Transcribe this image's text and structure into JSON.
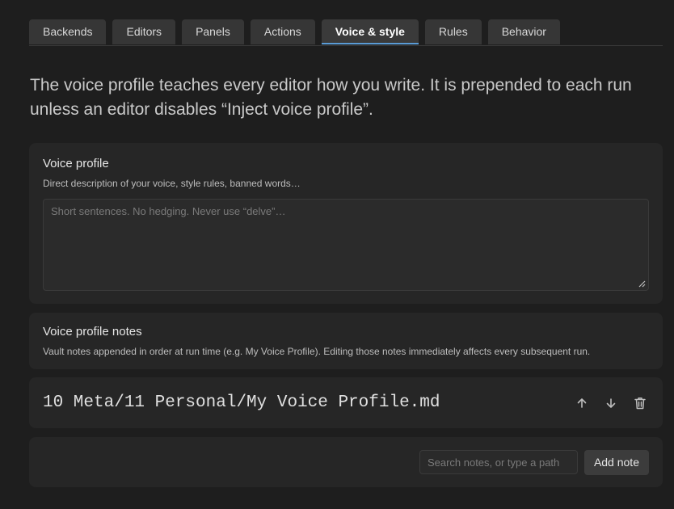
{
  "tabs": [
    {
      "label": "Backends",
      "active": false
    },
    {
      "label": "Editors",
      "active": false
    },
    {
      "label": "Panels",
      "active": false
    },
    {
      "label": "Actions",
      "active": false
    },
    {
      "label": "Voice & style",
      "active": true
    },
    {
      "label": "Rules",
      "active": false
    },
    {
      "label": "Behavior",
      "active": false
    }
  ],
  "intro": "The voice profile teaches every editor how you write. It is prepended to each run unless an editor disables “Inject voice profile”.",
  "voice_profile": {
    "title": "Voice profile",
    "description": "Direct description of your voice, style rules, banned words…",
    "value": "",
    "placeholder": "Short sentences. No hedging. Never use “delve”…"
  },
  "voice_notes": {
    "title": "Voice profile notes",
    "description": "Vault notes appended in order at run time (e.g. My Voice Profile). Editing those notes immediately affects every subsequent run.",
    "items": [
      {
        "path": "10 Meta/11 Personal/My Voice Profile.md"
      }
    ]
  },
  "add_note": {
    "search_placeholder": "Search notes, or type a path",
    "search_value": "",
    "button_label": "Add note"
  },
  "icons": {
    "move_up": "arrow-up-icon",
    "move_down": "arrow-down-icon",
    "delete": "trash-icon"
  },
  "colors": {
    "background": "#1e1e1e",
    "card": "#262626",
    "accent": "#5a9bd5"
  }
}
